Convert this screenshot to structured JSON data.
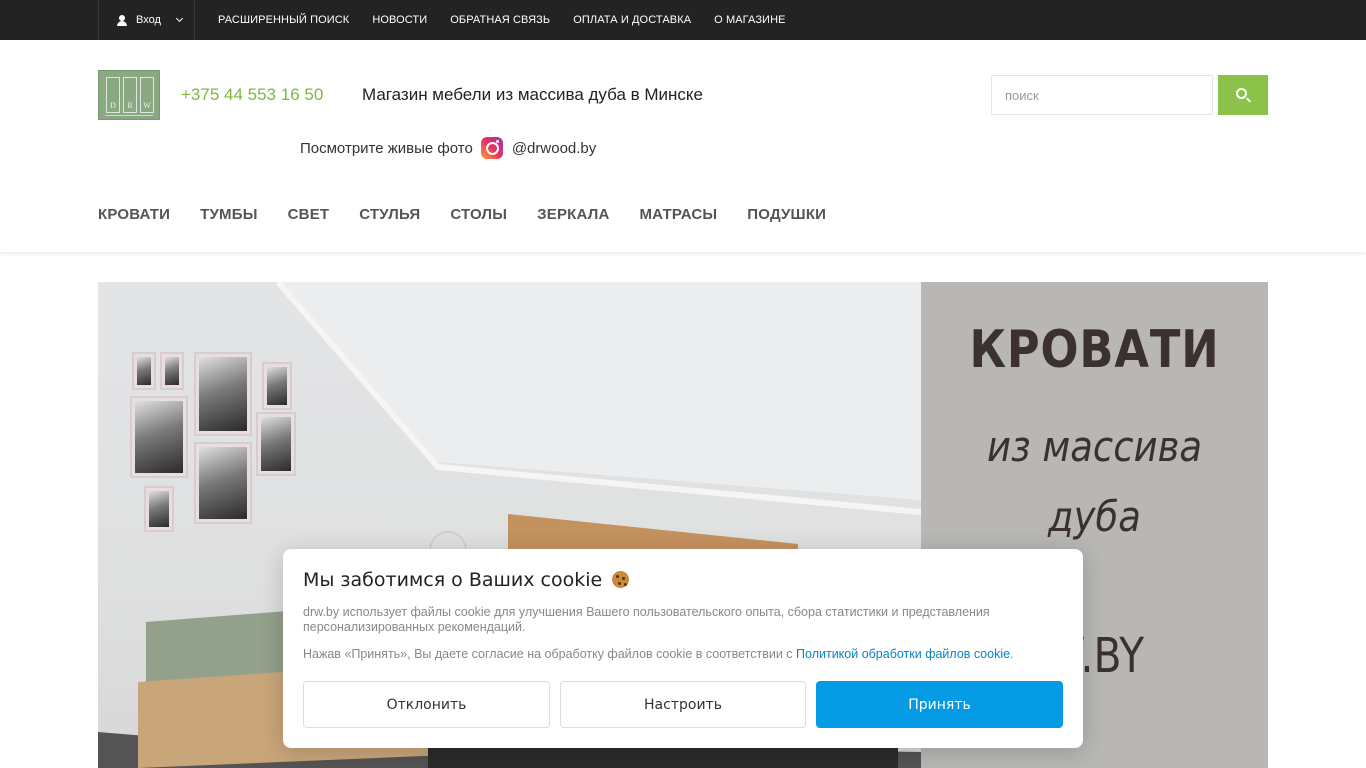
{
  "topbar": {
    "login_label": "Вход",
    "nav": [
      "РАСШИРЕННЫЙ ПОИСК",
      "НОВОСТИ",
      "ОБРАТНАЯ СВЯЗЬ",
      "ОПЛАТА И ДОСТАВКА",
      "О МАГАЗИНЕ"
    ]
  },
  "header": {
    "logo_letters": [
      "D",
      "R",
      "W"
    ],
    "phone": "+375 44 553 16 50",
    "tagline": "Магазин мебели из массива дуба в Минске",
    "instagram_prefix": "Посмотрите живые фото",
    "instagram_handle": "@drwood.by",
    "search_placeholder": "поиск",
    "search_value": "",
    "accent_color": "#8ac24a"
  },
  "main_nav": [
    "КРОВАТИ",
    "ТУМБЫ",
    "СВЕТ",
    "СТУЛЬЯ",
    "СТОЛЫ",
    "ЗЕРКАЛА",
    "МАТРАСЫ",
    "ПОДУШКИ"
  ],
  "banner": {
    "line1": "КРОВАТИ",
    "line2": "из массива",
    "line3": "дуба",
    "line4": "W.BY"
  },
  "cookie": {
    "title": "Мы заботимся о Ваших cookie",
    "text1": "drw.by использует файлы cookie для улучшения Вашего пользовательского опыта, сбора статистики и представления персонализированных рекомендаций.",
    "text2_prefix": "Нажав «Принять», Вы даете согласие на обработку файлов cookie в соответствии с",
    "text2_link": "Политикой обработки файлов cookie",
    "text2_suffix": ".",
    "decline_label": "Отклонить",
    "configure_label": "Настроить",
    "accept_label": "Принять",
    "accept_color": "#059ae4"
  }
}
